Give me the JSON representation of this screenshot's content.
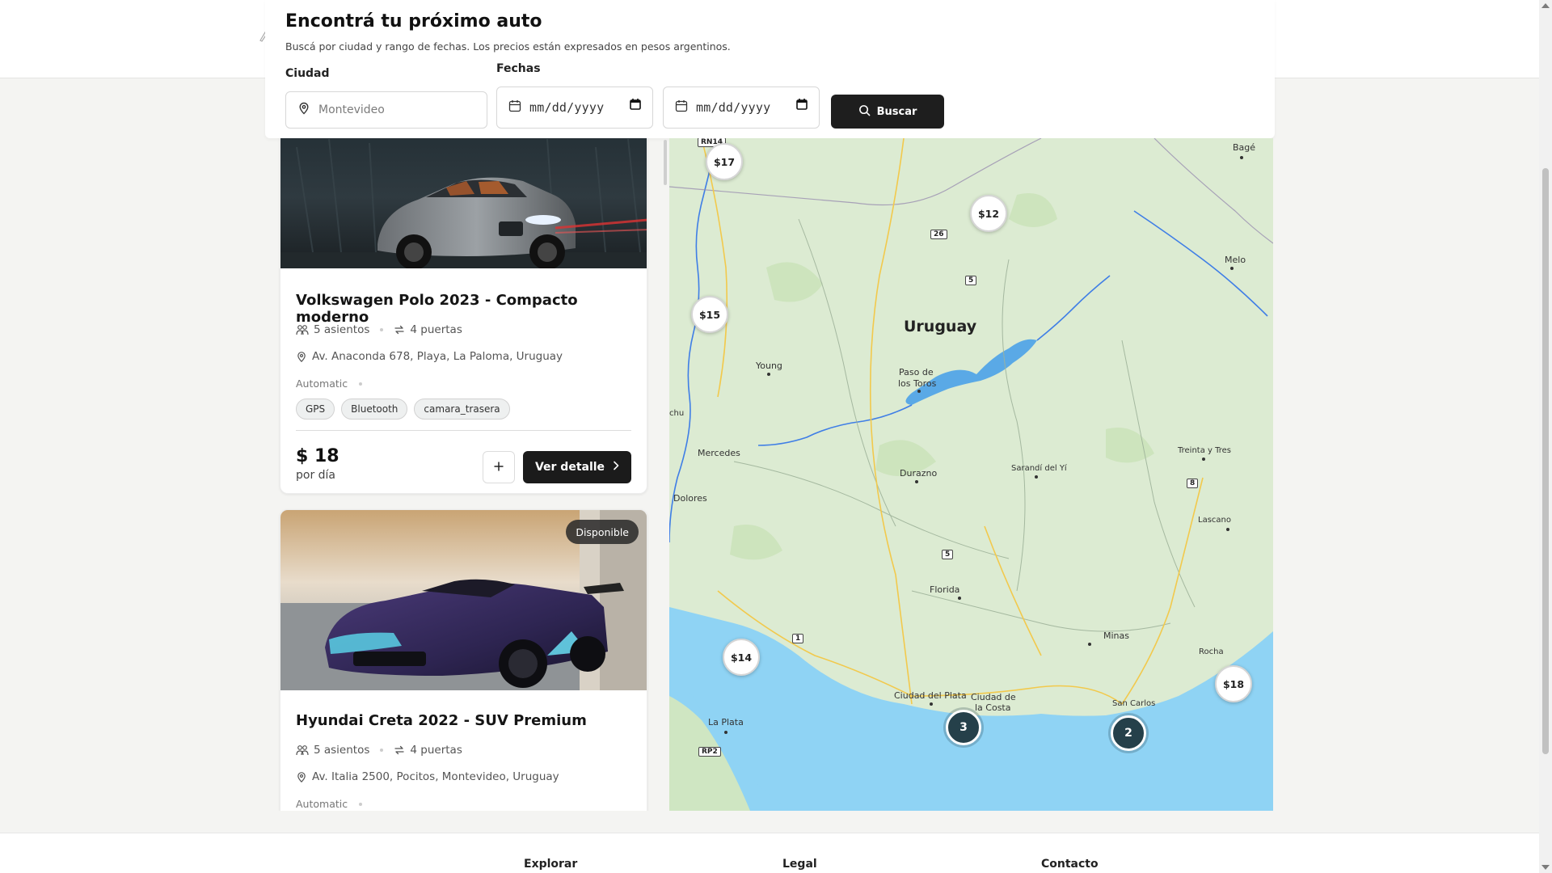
{
  "search": {
    "title": "Encontrá tu próximo auto",
    "subtitle": "Buscá por ciudad y rango de fechas. Los precios están expresados en pesos argentinos.",
    "city_label": "Ciudad",
    "city_placeholder": "Montevideo",
    "dates_label": "Fechas",
    "start_date_placeholder": "mm/dd/yyyy",
    "end_date_placeholder": "mm/dd/yyyy",
    "button_label": "Buscar"
  },
  "cars": [
    {
      "title": "Volkswagen Polo 2023 - Compacto moderno",
      "seats": "5 asientos",
      "doors": "4 puertas",
      "address": "Av. Anaconda 678, Playa, La Paloma, Uruguay",
      "transmission": "Automatic",
      "features": [
        "GPS",
        "Bluetooth",
        "camara_trasera"
      ],
      "price": "$ 18",
      "price_unit": "por día",
      "detail_label": "Ver detalle"
    },
    {
      "title": "Hyundai Creta 2022 - SUV Premium",
      "seats": "5 asientos",
      "doors": "4 puertas",
      "address": "Av. Italia 2500, Pocitos, Montevideo, Uruguay",
      "transmission": "Automatic",
      "badge": "Disponible"
    }
  ],
  "map": {
    "country_label": "Uruguay",
    "price_pins": [
      "$17",
      "$12",
      "$15",
      "$14",
      "$18"
    ],
    "clusters": [
      "3",
      "2"
    ],
    "places": [
      "Bagé",
      "Melo",
      "Young",
      "Paso de",
      "los Toros",
      "Mercedes",
      "Durazno",
      "Sarandí del Yí",
      "Treinta y Tres",
      "Dolores",
      "Lascano",
      "Florida",
      "Minas",
      "Rocha",
      "Ciudad del Plata",
      "Ciudad de",
      "la Costa",
      "San Carlos",
      "La Plata",
      "chu"
    ],
    "routes": [
      "RN14",
      "26",
      "5",
      "8",
      "5",
      "1",
      "RP2"
    ],
    "colors": {
      "water": "#8fd3f4",
      "land": "#dcebd2",
      "river": "#3f7ee6",
      "road": "#f2c94c"
    }
  },
  "footer": {
    "col1": "Explorar",
    "col2": "Legal",
    "col3": "Contacto"
  }
}
